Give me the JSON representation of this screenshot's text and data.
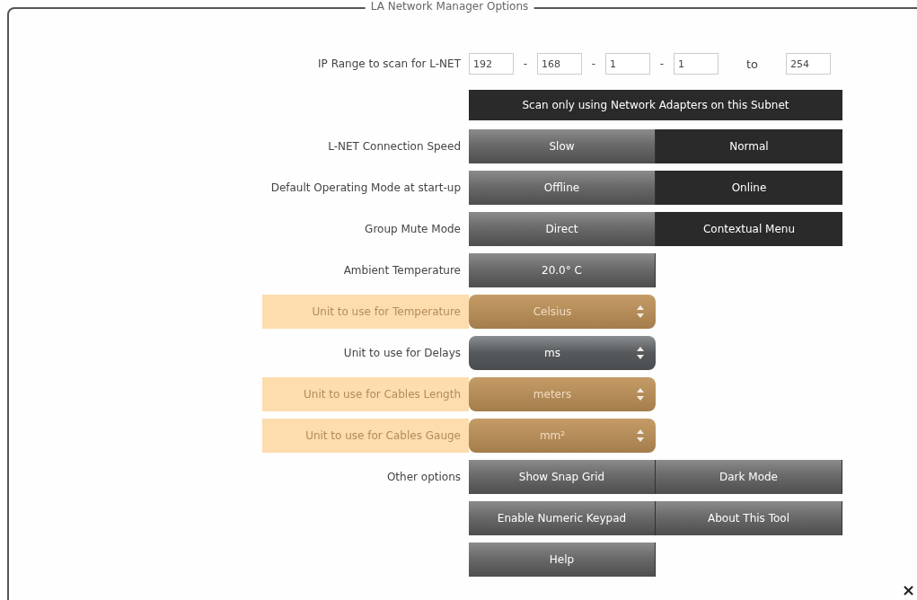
{
  "window": {
    "title": "LA Network Manager Options",
    "close": "×"
  },
  "rows": [
    {
      "kind": "ip",
      "label": "IP Range to scan for L-NET",
      "octets": [
        "192",
        "168",
        "1",
        "1"
      ],
      "separators": [
        "-",
        "-",
        "-"
      ],
      "to_label": "to",
      "end": "254"
    },
    {
      "kind": "toggle",
      "text": "Scan only using Network Adapters on this Subnet",
      "on": true
    },
    {
      "kind": "segmented",
      "label": "L-NET Connection Speed",
      "options": [
        {
          "label": "Slow",
          "selected": false
        },
        {
          "label": "Normal",
          "selected": true
        }
      ]
    },
    {
      "kind": "segmented",
      "label": "Default Operating Mode at start-up",
      "options": [
        {
          "label": "Offline",
          "selected": false
        },
        {
          "label": "Online",
          "selected": true
        }
      ]
    },
    {
      "kind": "segmented",
      "label": "Group Mute Mode",
      "options": [
        {
          "label": "Direct",
          "selected": false
        },
        {
          "label": "Contextual Menu",
          "selected": true
        }
      ]
    },
    {
      "kind": "value",
      "label": "Ambient Temperature",
      "value": "20.0° C"
    },
    {
      "kind": "select",
      "label": "Unit to use for Temperature",
      "value": "Celsius",
      "highlighted": true
    },
    {
      "kind": "select",
      "label": "Unit to use for Delays",
      "value": "ms",
      "highlighted": false
    },
    {
      "kind": "select",
      "label": "Unit to use for Cables Length",
      "value": "meters",
      "highlighted": true
    },
    {
      "kind": "select",
      "label": "Unit to use for Cables Gauge",
      "value": "mm²",
      "highlighted": true
    },
    {
      "kind": "buttons",
      "label": "Other options",
      "buttons": [
        "Show Snap Grid",
        "Dark Mode"
      ]
    },
    {
      "kind": "buttons",
      "buttons": [
        "Enable Numeric Keypad",
        "About This Tool"
      ]
    },
    {
      "kind": "buttons",
      "buttons": [
        "Help"
      ]
    }
  ]
}
